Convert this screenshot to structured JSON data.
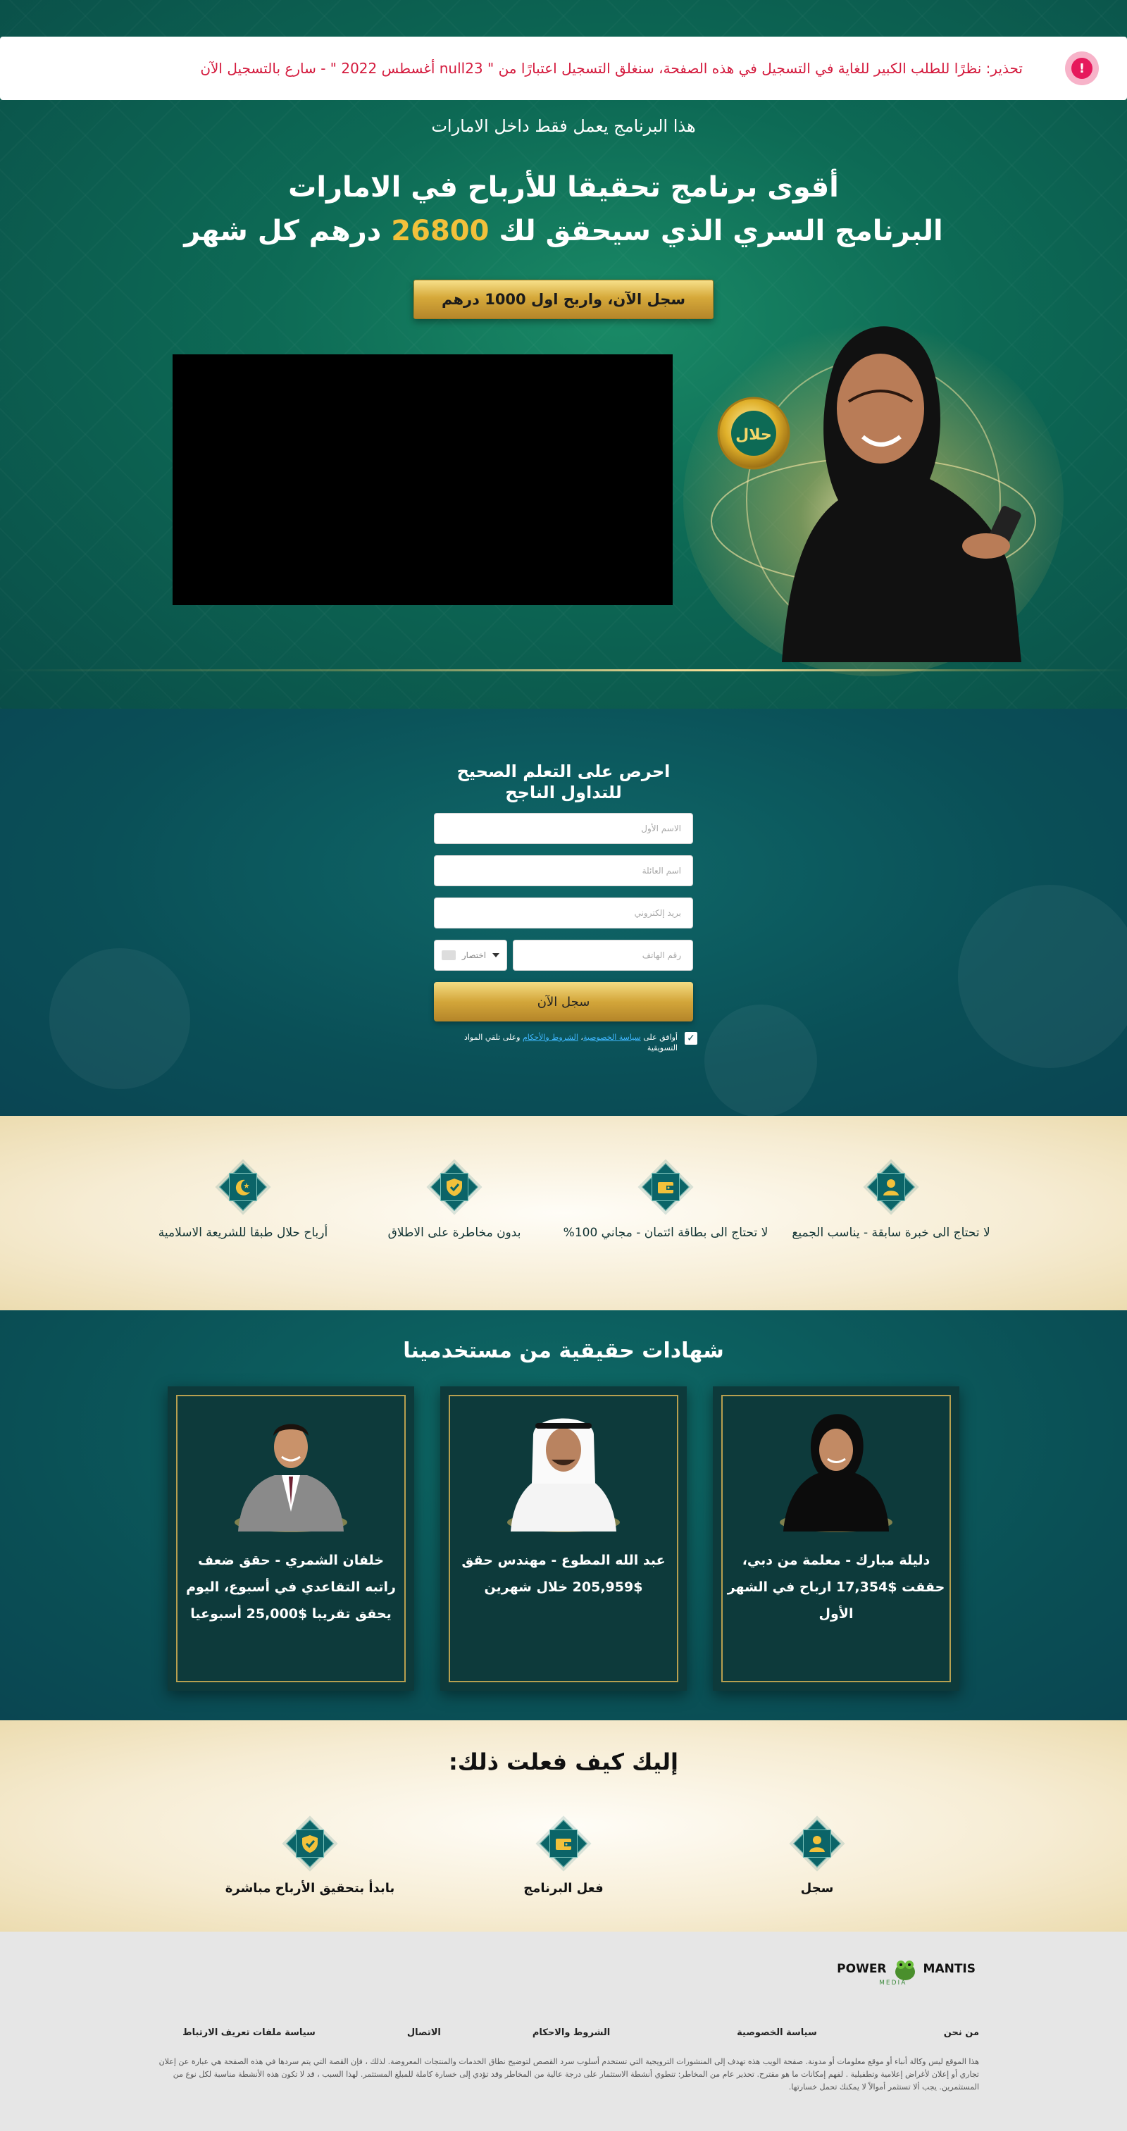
{
  "warning": {
    "text": "تحذير: نظرًا للطلب الكبير للغاية في التسجيل في هذه الصفحة، سنغلق التسجيل اعتبارًا من \" null23 أغسطس 2022 \" - سارع بالتسجيل الآن",
    "icon": "!"
  },
  "hero": {
    "subtitle": "هذا البرنامج يعمل فقط داخل الامارات",
    "title_line1": "أقوى برنامج تحقيقا للأرباح في الامارات",
    "title_line2_before": "البرنامج السري الذي سيحقق لك",
    "title_amount": "26800",
    "title_line2_after": "درهم كل شهر",
    "cta_label": "سجل الآن، واربح اول 1000 درهم",
    "badge_text": "حلال"
  },
  "form": {
    "title_line1": "احرص على التعلم الصحيح",
    "title_line2": "للتداول الناجح",
    "first_name_placeholder": "الاسم الأول",
    "last_name_placeholder": "اسم العائلة",
    "email_placeholder": "بريد إلكتروني",
    "phone_placeholder": "رقم الهاتف",
    "country_label": "اختصار",
    "submit_label": "سجل الآن",
    "consent_prefix": "أوافق على",
    "consent_privacy": "سياسة الخصوصية",
    "consent_terms": "الشروط والأحكام",
    "consent_suffix": "وعلى تلقي المواد التسويقية",
    "checkbox_mark": "✓"
  },
  "features": [
    {
      "icon": "user-icon",
      "text": "لا تحتاج الى خبرة سابقة - يناسب الجميع"
    },
    {
      "icon": "wallet-icon",
      "text": "لا تحتاج الى بطاقة ائتمان - مجاني 100%"
    },
    {
      "icon": "shield-icon",
      "text": "بدون مخاطرة على الاطلاق"
    },
    {
      "icon": "crescent-icon",
      "text": "أرباح حلال طبقا للشريعة الاسلامية"
    }
  ],
  "testimonials": {
    "title": "شهادات حقيقية من مستخدمينا",
    "cards": [
      {
        "text": "دليلة مبارك - معلمة من دبي، حققت $17,354 ارباح في الشهر الأول"
      },
      {
        "text": "عبد الله المطوع - مهندس حقق $205,959 خلال شهرين"
      },
      {
        "text": "خلفان الشمري - حقق ضعف راتبه التقاعدي في أسبوع، اليوم يحقق تقريبا $25,000 أسبوعيا"
      }
    ]
  },
  "how": {
    "title": "إليك كيف فعلت ذلك:",
    "steps": [
      {
        "icon": "user-icon",
        "label": "سجل"
      },
      {
        "icon": "wallet-icon",
        "label": "فعل البرنامج"
      },
      {
        "icon": "shield-icon",
        "label": "بابدأ بتحقيق الأرباح مباشرة"
      }
    ]
  },
  "footer": {
    "logo_left": "POWER",
    "logo_right": "MANTIS",
    "logo_sub": "MEDIA",
    "links": [
      "من نحن",
      "سياسة الخصوصية",
      "الشروط والاحكام",
      "الاتصال",
      "سياسة ملفات تعريف الارتباط"
    ],
    "disclaimer": "هذا الموقع ليس وكالة أنباء أو موقع معلومات أو مدونة. صفحة الويب هذه تهدف إلى المنشورات الترويجية التي تستخدم أسلوب سرد القصص لتوضيح نطاق الخدمات والمنتجات المعروضة. لذلك ، فإن القصة التي يتم سردها في هذه الصفحة هي عبارة عن إعلان تجاري أو إعلان لأغراض إعلامية وتطفيلية . لفهم إمكانات ما هو مقترح. تحذير عام من المخاطر: تنطوي أنشطة الاستثمار على درجة عالية من المخاطر وقد تؤدي إلى خسارة كاملة للمبلغ المستثمر. لهذا السبب ، قد لا تكون هذه الأنشطة مناسبة لكل نوع من المستثمرين. يجب ألا تستثمر أموالاً لا يمكنك تحمل خسارتها."
  },
  "colors": {
    "gold": "#f2c13b",
    "teal_dark": "#0a4f55",
    "warning_red": "#d41a3d"
  }
}
